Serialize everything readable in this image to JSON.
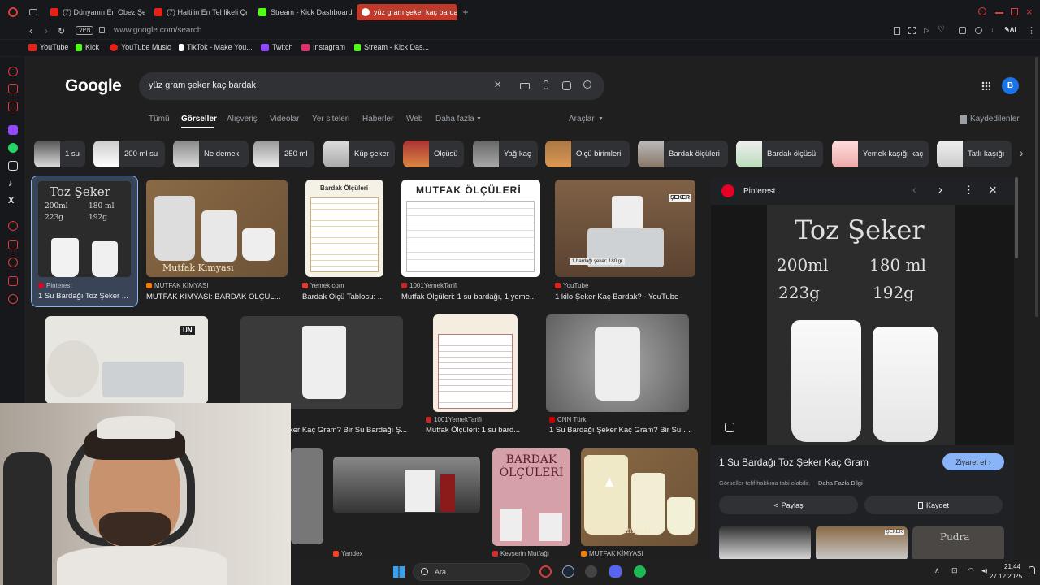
{
  "tabs": [
    {
      "label": "(7) Dünyanın En Obez Şeh",
      "icon_color": "#e62117"
    },
    {
      "label": "(7) Haiti'in En Tehlikeli Çet",
      "icon_color": "#e62117"
    },
    {
      "label": "Stream - Kick Dashboard",
      "icon_color": "#53fc18"
    },
    {
      "label": "yüz gram şeker kaç bardak",
      "icon_color": "#ffffff"
    }
  ],
  "address": {
    "vpn": "VPN",
    "url": "www.google.com/search"
  },
  "bookmarks": [
    {
      "label": "YouTube",
      "icon_color": "#e62117"
    },
    {
      "label": "Kick",
      "icon_color": "#53fc18"
    },
    {
      "label": "YouTube Music",
      "icon_color": "#e62117"
    },
    {
      "label": "TikTok - Make You...",
      "icon_color": "#ffffff"
    },
    {
      "label": "Twitch",
      "icon_color": "#9146ff"
    },
    {
      "label": "Instagram",
      "icon_color": "#e1306c"
    },
    {
      "label": "Stream - Kick Das...",
      "icon_color": "#53fc18"
    }
  ],
  "google": {
    "logo": "Google",
    "query": "yüz gram şeker kaç bardak",
    "avatar": "B",
    "nav": [
      "Tümü",
      "Görseller",
      "Alışveriş",
      "Videolar",
      "Yer siteleri",
      "Haberler",
      "Web",
      "Daha fazla"
    ],
    "tools": "Araçlar",
    "saved": "Kaydedilenler"
  },
  "chips": [
    "1 su",
    "200 ml su",
    "Ne demek",
    "250 ml",
    "Küp şeker",
    "Ölçüsü",
    "Yağ kaç",
    "Ölçü birimleri",
    "Bardak ölçüleri",
    "Bardak ölçüsü",
    "Yemek kaşığı kaç",
    "Tatlı kaşığı"
  ],
  "results_row1": [
    {
      "source": "Pinterest",
      "title": "1 Su Bardağı Toz Şeker ...",
      "src_color": "#e60023"
    },
    {
      "source": "MUTFAK KİMYASI",
      "title": "MUTFAK KİMYASI: BARDAK ÖLÇÜL...",
      "src_color": "#f57c00"
    },
    {
      "source": "Yemek.com",
      "title": "Bardak Ölçü Tablosu: ...",
      "src_color": "#e53935"
    },
    {
      "source": "1001YemekTarifi",
      "title": "Mutfak Ölçüleri: 1 su bardağı, 1 yeme...",
      "src_color": "#c62828"
    },
    {
      "source": "YouTube",
      "title": "1 kilo Şeker Kaç Bardak? - YouTube",
      "src_color": "#e62117"
    }
  ],
  "results_row2": [
    {
      "source": "",
      "title": "ker Kaç Gram? Bir Su Bardağı Ş..."
    },
    {
      "source": "1001YemekTarifi",
      "title": "Mutfak Ölçüleri: 1 su bard...",
      "src_color": "#c62828"
    },
    {
      "source": "CNN Türk",
      "title": "1 Su Bardağı Şeker Kaç Gram? Bir Su Bar...",
      "src_color": "#cc0000"
    }
  ],
  "results_row3": [
    {
      "source": "Yandex",
      "src_color": "#fc3f1d"
    },
    {
      "source": "Kevserin Mutfağı",
      "src_color": "#d32f2f"
    },
    {
      "source": "MUTFAK KİMYASI",
      "src_color": "#f57c00"
    }
  ],
  "image_text": {
    "chalk_title": "Toz Şeker",
    "chalk_line1_a": "200ml",
    "chalk_line1_b": "180 ml",
    "chalk_line2_a": "223g",
    "chalk_line2_b": "192g",
    "mk_watermark": "Mutfak Kimyası",
    "table_title": "Bardak Ölçüleri",
    "mutfak_title": "MUTFAK ÖLÇÜLERİ",
    "seker_label": "ŞEKER",
    "yt_caption": "1 bardağı şeker: 180 gr",
    "un_label": "UN",
    "bardak_olculeri": "BARDAK ÖLÇÜLERİ",
    "pudra": "Pudra"
  },
  "panel": {
    "source": "Pinterest",
    "title": "1 Su Bardağı Toz Şeker Kaç Gram",
    "visit": "Ziyaret et",
    "copyright": "Görseller telif hakkına tabi olabilir.",
    "more_info": "Daha Fazla Bilgi",
    "share": "Paylaş",
    "save": "Kaydet"
  },
  "taskbar": {
    "search": "Ara",
    "time": "21:44",
    "date": "27.12.2025"
  }
}
